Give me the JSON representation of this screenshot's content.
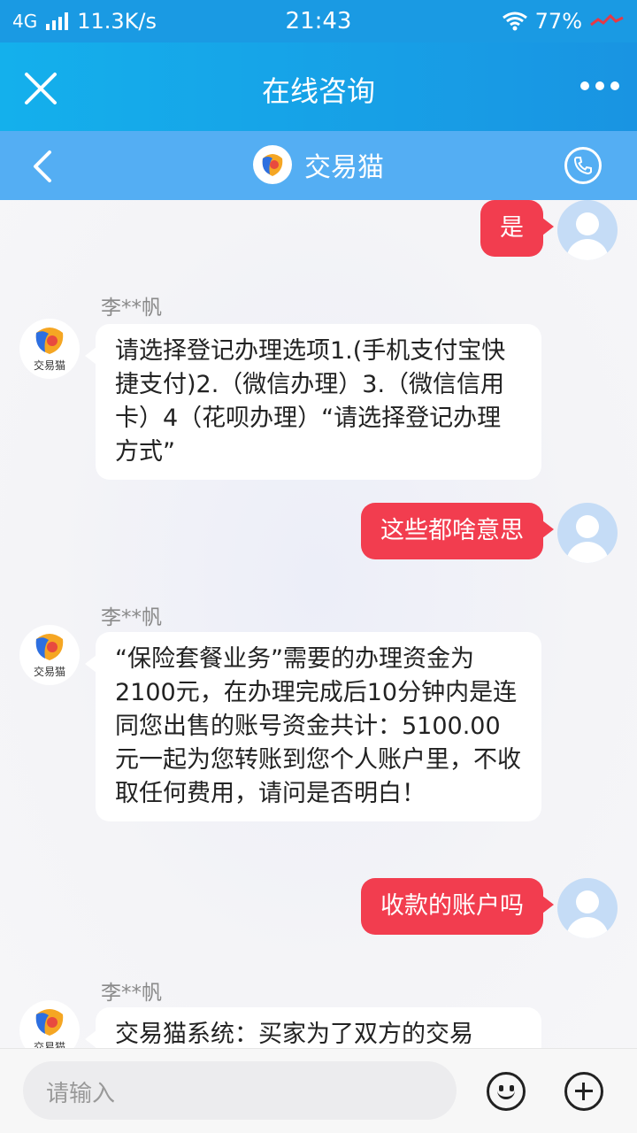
{
  "status_bar": {
    "network": "4G",
    "speed": "11.3K/s",
    "time": "21:43",
    "battery": "77%"
  },
  "header": {
    "title": "在线咨询"
  },
  "subheader": {
    "title": "交易猫",
    "logo_caption": "交易猫"
  },
  "messages": [
    {
      "side": "out",
      "text": "是"
    },
    {
      "side": "in",
      "sender": "李**帆",
      "avatar_caption": "交易猫",
      "text": "请选择登记办理选项1.(手机支付宝快捷支付)2.（微信办理）3.（微信信用卡）4（花呗办理）“请选择登记办理方式”"
    },
    {
      "side": "out",
      "text": "这些都啥意思"
    },
    {
      "side": "in",
      "sender": "李**帆",
      "avatar_caption": "交易猫",
      "text": "“保险套餐业务”需要的办理资金为2100元，在办理完成后10分钟内是连同您出售的账号资金共计：5100.00元一起为您转账到您个人账户里，不收取任何费用，请问是否明白！"
    },
    {
      "side": "out",
      "text": "收款的账户吗"
    },
    {
      "side": "in",
      "sender": "李**帆",
      "avatar_caption": "交易猫",
      "text": "交易猫系统：买家为了双方的交易"
    }
  ],
  "input": {
    "placeholder": "请输入"
  },
  "colors": {
    "header_bg": "#1a9ae3",
    "subheader_bg": "#54aef3",
    "outgoing_bubble": "#f23d4f",
    "incoming_bubble": "#ffffff"
  },
  "icons": [
    "close-icon",
    "more-icon",
    "back-icon",
    "phone-icon",
    "emoji-icon",
    "plus-icon",
    "wifi-icon",
    "signal-icon"
  ]
}
